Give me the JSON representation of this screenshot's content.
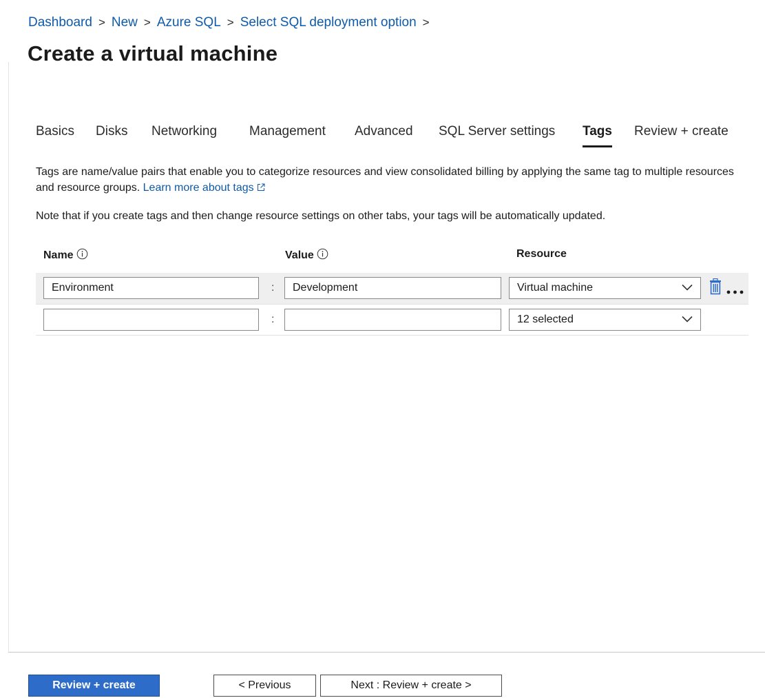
{
  "breadcrumb": {
    "items": [
      "Dashboard",
      "New",
      "Azure SQL",
      "Select SQL deployment option"
    ],
    "separator": ">"
  },
  "page": {
    "title": "Create a virtual machine"
  },
  "tabs": [
    {
      "label": "Basics",
      "active": false
    },
    {
      "label": "Disks",
      "active": false
    },
    {
      "label": "Networking",
      "active": false
    },
    {
      "label": "Management",
      "active": false
    },
    {
      "label": "Advanced",
      "active": false
    },
    {
      "label": "SQL Server settings",
      "active": false
    },
    {
      "label": "Tags",
      "active": true
    },
    {
      "label": "Review + create",
      "active": false
    }
  ],
  "content": {
    "description": "Tags are name/value pairs that enable you to categorize resources and view consolidated billing by applying the same tag to multiple resources and resource groups.",
    "learn_more_link": "Learn more about tags",
    "note": "Note that if you create tags and then change resource settings on other tabs, your tags will be automatically updated."
  },
  "table": {
    "headers": {
      "name": "Name",
      "value": "Value",
      "resource": "Resource"
    },
    "separator": ":",
    "rows": [
      {
        "name": "Environment",
        "value": "Development",
        "resource": "Virtual machine"
      },
      {
        "name": "",
        "value": "",
        "resource": "12 selected"
      }
    ]
  },
  "footer": {
    "review_create_label": "Review + create",
    "previous_label": "< Previous",
    "next_label": "Next : Review + create >"
  },
  "colors": {
    "link": "#0f5aa8",
    "primary_button": "#2d6cc9",
    "row_highlight": "#efefef",
    "delete_icon": "#2d6cc9"
  },
  "icons": {
    "info": "info-circle-icon",
    "external_link": "external-link-icon",
    "chevron": "chevron-down-icon",
    "delete": "trash-icon",
    "more": "ellipsis-icon"
  }
}
